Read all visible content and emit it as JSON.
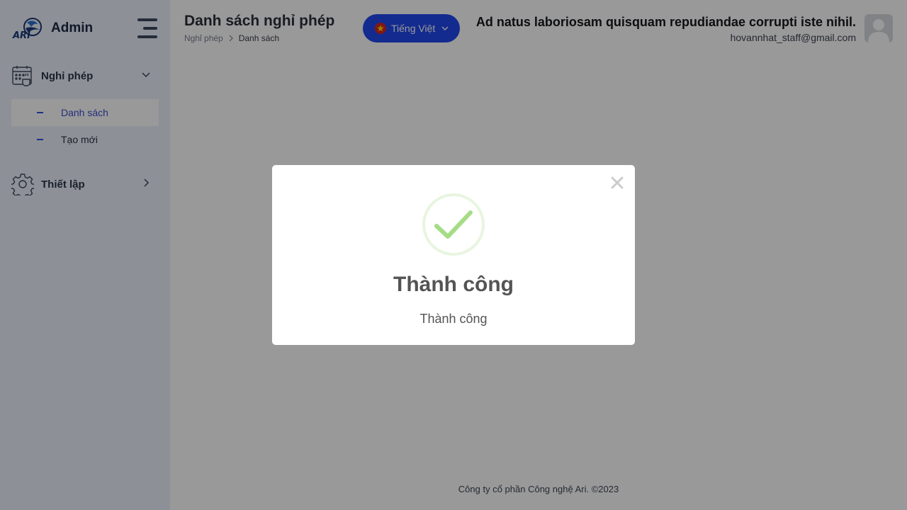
{
  "brand": {
    "name": "Admin",
    "logo_text": "ARI"
  },
  "sidebar": {
    "groups": [
      {
        "label": "Nghỉ phép",
        "icon": "calendar-coffee-icon",
        "expanded": true,
        "items": [
          {
            "label": "Danh sách",
            "active": true
          },
          {
            "label": "Tạo mới",
            "active": false
          }
        ]
      },
      {
        "label": "Thiết lập",
        "icon": "gear-icon",
        "expanded": false,
        "items": []
      }
    ]
  },
  "header": {
    "title": "Danh sách nghỉ phép",
    "breadcrumb": [
      "Nghỉ phép",
      "Danh sách"
    ],
    "language": {
      "label": "Tiếng Việt",
      "flag": "vietnam-flag-icon"
    },
    "user": {
      "name": "Ad natus laboriosam quisquam repudiandae corrupti iste nihil.",
      "email": "hovannhat_staff@gmail.com"
    }
  },
  "footer": {
    "text": "Công ty cổ phần Công nghệ Ari. ©2023"
  },
  "modal": {
    "icon": "success-check-icon",
    "title": "Thành công",
    "message": "Thành công"
  },
  "colors": {
    "accent": "#2149ee",
    "sidebar_bg": "#ecf0fb",
    "success": "#a5dc86",
    "overlay": "rgba(0,0,0,0.4)"
  }
}
